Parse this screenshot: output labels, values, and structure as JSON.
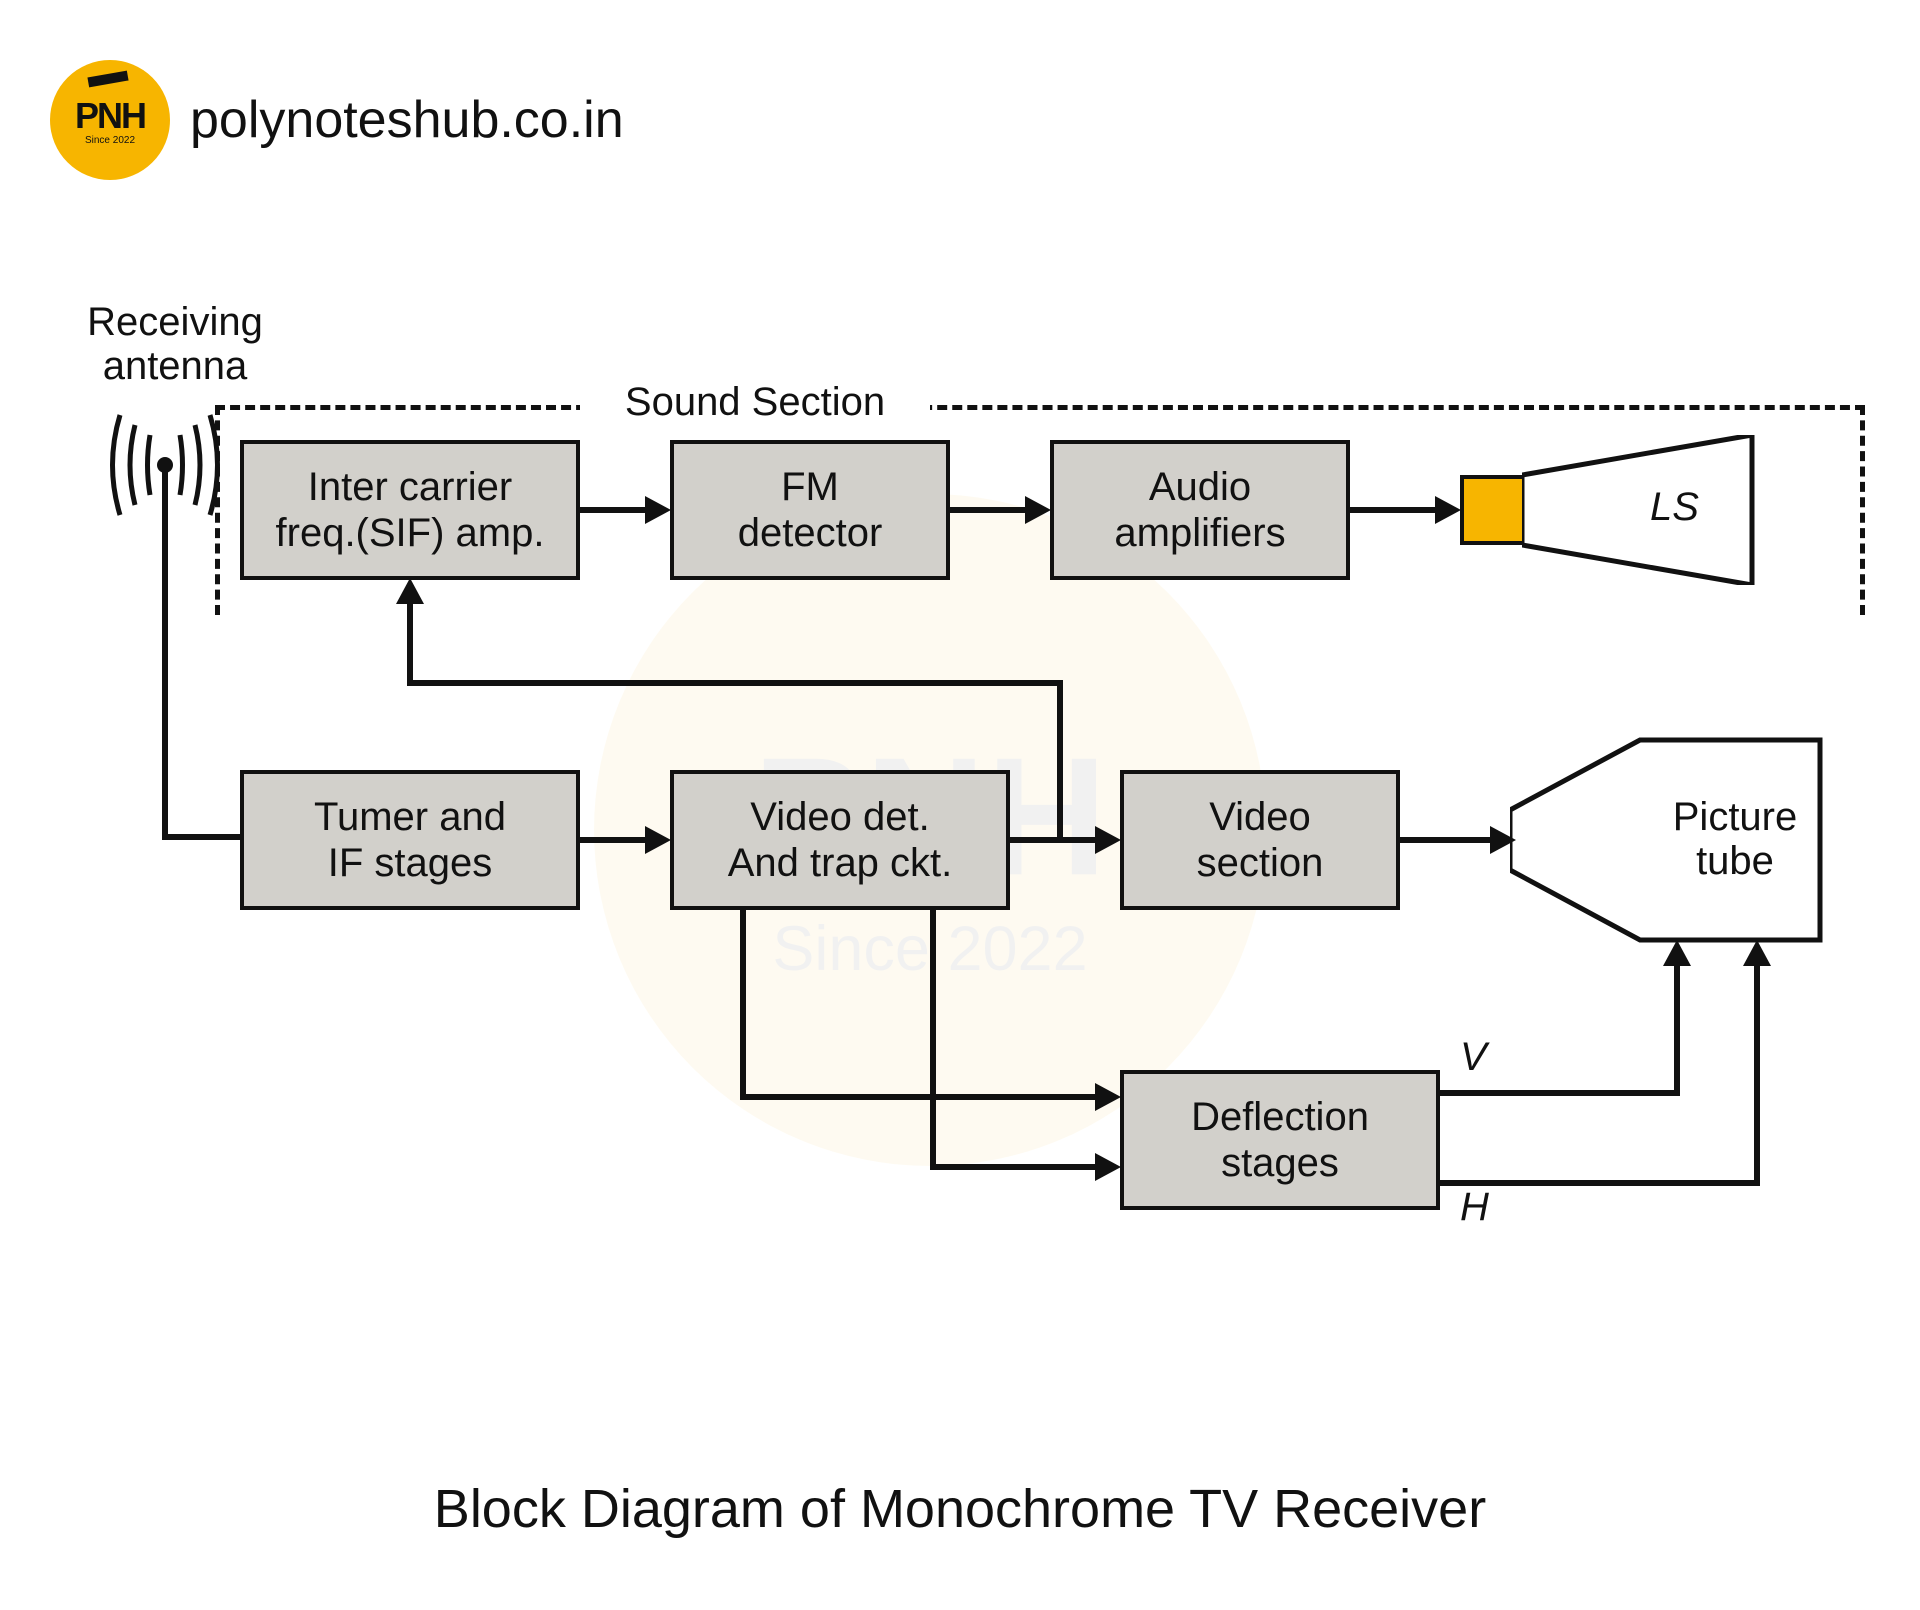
{
  "site": "polynoteshub.co.in",
  "logo": {
    "text": "PNH",
    "sub": "Since 2022"
  },
  "caption": "Block Diagram of Monochrome TV Receiver",
  "labels": {
    "antenna": "Receiving\nantenna",
    "sound_section": "Sound Section",
    "ls": "LS",
    "v": "V",
    "h": "H"
  },
  "blocks": {
    "sif": "Inter carrier\nfreq.(SIF) amp.",
    "fm": "FM\ndetector",
    "audio": "Audio\namplifiers",
    "tuner": "Tumer and\nIF stages",
    "videodet": "Video det.\nAnd trap ckt.",
    "videosec": "Video\nsection",
    "deflect": "Deflection\nstages",
    "picture": "Picture\ntube"
  }
}
